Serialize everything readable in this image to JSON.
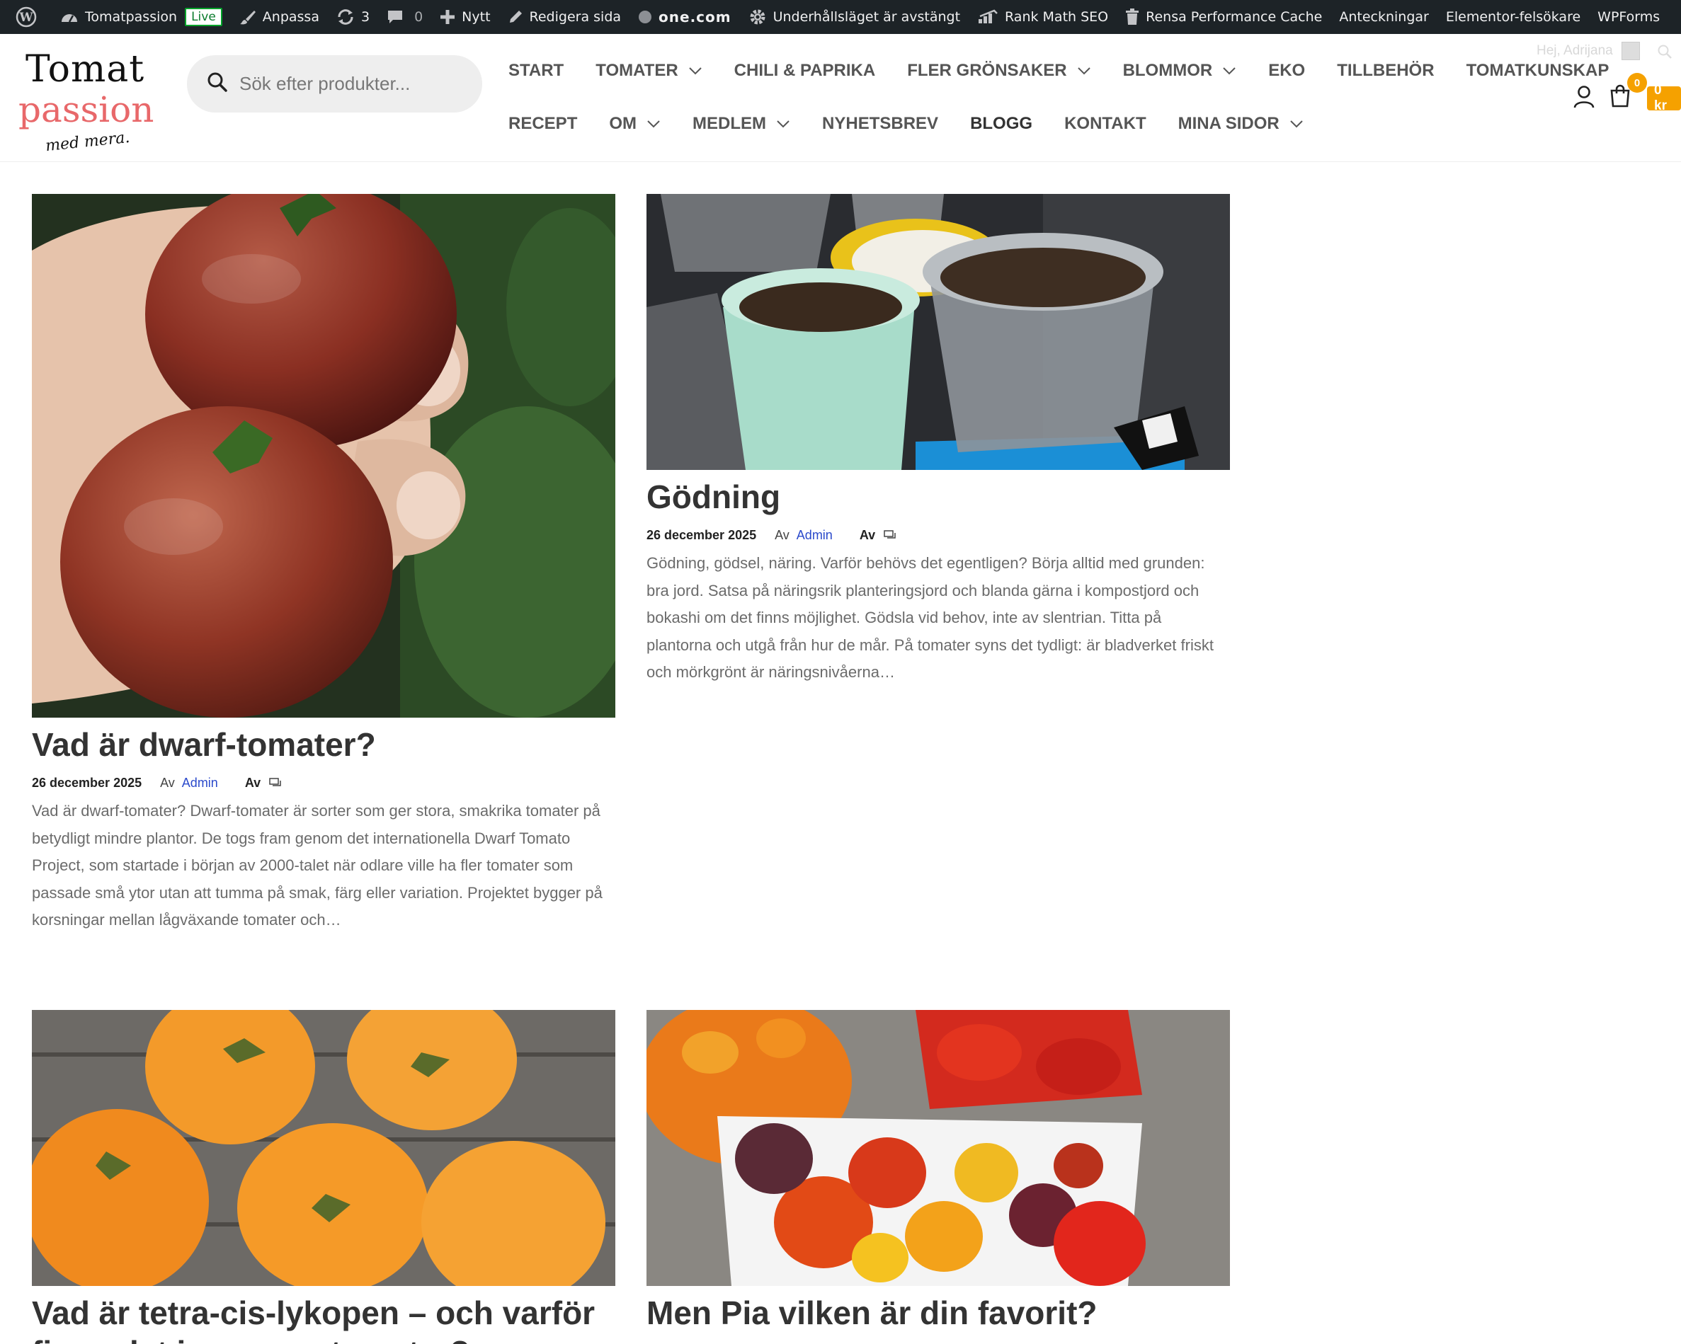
{
  "adminbar": {
    "site_name": "Tomatpassion",
    "live_badge": "Live",
    "customize": "Anpassa",
    "updates_count": "3",
    "comments_count": "0",
    "new": "Nytt",
    "edit_page": "Redigera sida",
    "onecom": "one.com",
    "maintenance": "Underhållsläget är avstängt",
    "rankmath": "Rank Math SEO",
    "cache": "Rensa Performance Cache",
    "notes": "Anteckningar",
    "elementor": "Elementor-felsökare",
    "wpforms": "WPForms"
  },
  "logo": {
    "line1": "Tomat",
    "line2": "passion",
    "line3": "med mera."
  },
  "search": {
    "placeholder": "Sök efter produkter..."
  },
  "nav": {
    "row1": [
      {
        "label": "START",
        "dropdown": false
      },
      {
        "label": "TOMATER",
        "dropdown": true
      },
      {
        "label": "CHILI & PAPRIKA",
        "dropdown": false
      },
      {
        "label": "FLER GRÖNSAKER",
        "dropdown": true
      },
      {
        "label": "BLOMMOR",
        "dropdown": true
      },
      {
        "label": "EKO",
        "dropdown": false
      },
      {
        "label": "TILLBEHÖR",
        "dropdown": false
      },
      {
        "label": "TOMATKUNSKAP",
        "dropdown": false
      }
    ],
    "row2": [
      {
        "label": "RECEPT",
        "dropdown": false
      },
      {
        "label": "OM",
        "dropdown": true
      },
      {
        "label": "MEDLEM",
        "dropdown": true
      },
      {
        "label": "NYHETSBREV",
        "dropdown": false
      },
      {
        "label": "BLOGG",
        "dropdown": false
      },
      {
        "label": "KONTAKT",
        "dropdown": false
      },
      {
        "label": "MINA SIDOR",
        "dropdown": true
      }
    ]
  },
  "account": {
    "greeting": "Hej, Adrijana"
  },
  "cart": {
    "count": "0",
    "total": "0 kr"
  },
  "posts": [
    {
      "title": "Vad är dwarf-tomater?",
      "date": "26 december 2025",
      "by": "Av",
      "author": "Admin",
      "comments_by": "Av",
      "excerpt": "Vad är dwarf-tomater? Dwarf-tomater är sorter som ger stora, smakrika tomater på betydligt mindre plantor. De togs fram genom det internationella Dwarf Tomato Project, som startade i början av 2000-talet när odlare ville ha fler tomater som passade små ytor utan att tumma på smak, färg eller variation. Projektet bygger på korsningar mellan lågväxande tomater och…"
    },
    {
      "title": "Gödning",
      "date": "26 december 2025",
      "by": "Av",
      "author": "Admin",
      "comments_by": "Av",
      "excerpt": "Gödning, gödsel, näring. Varför behövs det egentligen? Börja alltid med grunden: bra jord. Satsa på näringsrik planteringsjord och blanda gärna i kompostjord och bokashi om det finns möjlighet. Gödsla vid behov, inte av slentrian. Titta på plantorna och utgå från hur de mår. På tomater syns det tydligt: är bladverket friskt och mörkgrönt är näringsnivåerna…"
    },
    {
      "title": "Vad är tetra-cis-lykopen – och varför finns det i orangea tomater?"
    },
    {
      "title": "Men Pia vilken är din favorit?"
    }
  ]
}
